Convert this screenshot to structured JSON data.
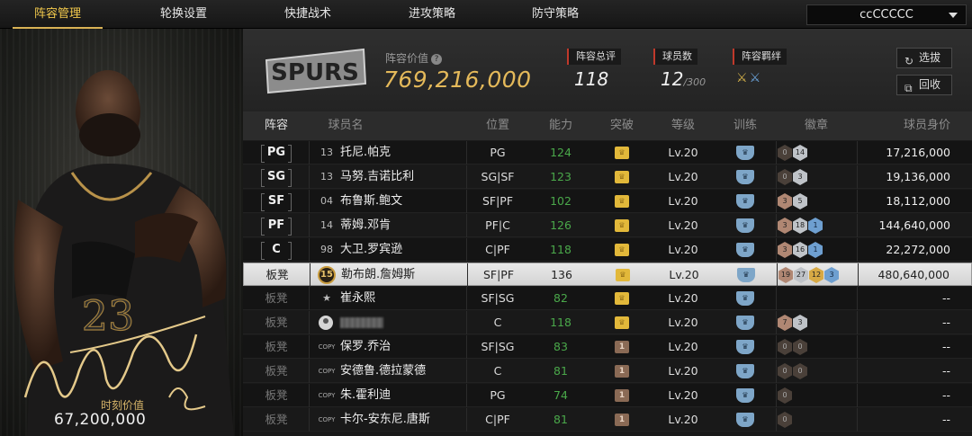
{
  "nav": {
    "tabs": [
      "阵容管理",
      "轮换设置",
      "快捷战术",
      "进攻策略",
      "防守策略"
    ],
    "active_tab": 0,
    "team_select": "ccCCCCC"
  },
  "card": {
    "jersey_number": "23",
    "value_label": "时刻价值",
    "value": "67,200,000"
  },
  "header": {
    "logo_text": "SPURS",
    "lineup_value_label": "阵容价值",
    "lineup_value": "769,216,000",
    "overall_label": "阵容总评",
    "overall_value": "118",
    "count_label": "球员数",
    "count_value": "12",
    "count_max": "/300",
    "bond_label": "阵容羁绊",
    "buttons": {
      "select": "选拔",
      "recycle": "回收"
    }
  },
  "table": {
    "headers": [
      "阵容",
      "球员名",
      "位置",
      "能力",
      "突破",
      "等级",
      "训练",
      "徽章",
      "球员身价"
    ],
    "rows": [
      {
        "slot": "PG",
        "starter": true,
        "num": "13",
        "name": "托尼.帕克",
        "pos": "PG",
        "ability": "124",
        "ability_green": true,
        "breakthrough": "gold",
        "level": "Lv.20",
        "badges": [
          [
            "dark",
            "0"
          ],
          [
            "silver",
            "14"
          ]
        ],
        "salary": "17,216,000"
      },
      {
        "slot": "SG",
        "starter": true,
        "num": "13",
        "name": "马努.吉诺比利",
        "pos": "SG|SF",
        "ability": "123",
        "ability_green": true,
        "breakthrough": "gold",
        "level": "Lv.20",
        "badges": [
          [
            "dark",
            "0"
          ],
          [
            "silver",
            "3"
          ]
        ],
        "salary": "19,136,000"
      },
      {
        "slot": "SF",
        "starter": true,
        "num": "04",
        "name": "布鲁斯.鲍文",
        "pos": "SF|PF",
        "ability": "102",
        "ability_green": true,
        "breakthrough": "gold",
        "level": "Lv.20",
        "badges": [
          [
            "bronze",
            "3"
          ],
          [
            "silver",
            "5"
          ]
        ],
        "salary": "18,112,000"
      },
      {
        "slot": "PF",
        "starter": true,
        "num": "14",
        "name": "蒂姆.邓肯",
        "pos": "PF|C",
        "ability": "126",
        "ability_green": true,
        "breakthrough": "gold",
        "level": "Lv.20",
        "badges": [
          [
            "bronze",
            "3"
          ],
          [
            "silver",
            "18"
          ],
          [
            "blue",
            "1"
          ]
        ],
        "salary": "144,640,000"
      },
      {
        "slot": "C",
        "starter": true,
        "num": "98",
        "name": "大卫.罗宾逊",
        "pos": "C|PF",
        "ability": "118",
        "ability_green": true,
        "breakthrough": "gold",
        "level": "Lv.20",
        "badges": [
          [
            "bronze",
            "3"
          ],
          [
            "silver",
            "16"
          ],
          [
            "blue",
            "1"
          ]
        ],
        "salary": "22,272,000"
      },
      {
        "slot": "板凳",
        "starter": false,
        "selected": true,
        "num": "15",
        "name": "勒布朗.詹姆斯",
        "pos": "SF|PF",
        "ability": "136",
        "ability_green": false,
        "breakthrough": "gold",
        "level": "Lv.20",
        "badges": [
          [
            "bronze",
            "19"
          ],
          [
            "silver",
            "27"
          ],
          [
            "gold",
            "12"
          ],
          [
            "blue",
            "3"
          ]
        ],
        "salary": "480,640,000"
      },
      {
        "slot": "板凳",
        "starter": false,
        "num": "",
        "name": "崔永熙",
        "pos": "SF|SG",
        "ability": "82",
        "ability_green": true,
        "breakthrough": "gold",
        "level": "Lv.20",
        "badges": [],
        "salary": "--"
      },
      {
        "slot": "板凳",
        "starter": false,
        "num": "",
        "name": "",
        "pos": "C",
        "ability": "118",
        "ability_green": true,
        "breakthrough": "gold",
        "level": "Lv.20",
        "badges": [
          [
            "bronze",
            "7"
          ],
          [
            "silver",
            "3"
          ]
        ],
        "salary": "--"
      },
      {
        "slot": "板凳",
        "starter": false,
        "num": "COPY",
        "name": "保罗.乔治",
        "pos": "SF|SG",
        "ability": "83",
        "ability_green": true,
        "breakthrough": "bronze",
        "level": "Lv.20",
        "badges": [
          [
            "dark",
            "0"
          ],
          [
            "dark",
            "0"
          ]
        ],
        "salary": "--"
      },
      {
        "slot": "板凳",
        "starter": false,
        "num": "COPY",
        "name": "安德鲁.德拉蒙德",
        "pos": "C",
        "ability": "81",
        "ability_green": true,
        "breakthrough": "bronze",
        "level": "Lv.20",
        "badges": [
          [
            "dark",
            "0"
          ],
          [
            "dark",
            "0"
          ]
        ],
        "salary": "--"
      },
      {
        "slot": "板凳",
        "starter": false,
        "num": "COPY",
        "name": "朱.霍利迪",
        "pos": "PG",
        "ability": "74",
        "ability_green": true,
        "breakthrough": "bronze",
        "level": "Lv.20",
        "badges": [
          [
            "dark",
            "0"
          ]
        ],
        "salary": "--"
      },
      {
        "slot": "板凳",
        "starter": false,
        "num": "COPY",
        "name": "卡尔-安东尼.唐斯",
        "pos": "C|PF",
        "ability": "81",
        "ability_green": true,
        "breakthrough": "bronze",
        "level": "Lv.20",
        "badges": [
          [
            "dark",
            "0"
          ]
        ],
        "salary": "--"
      }
    ]
  },
  "colors": {
    "accent_gold": "#e4b95a",
    "ability_green": "#4aa84a",
    "stat_marker": "#c0392b"
  }
}
